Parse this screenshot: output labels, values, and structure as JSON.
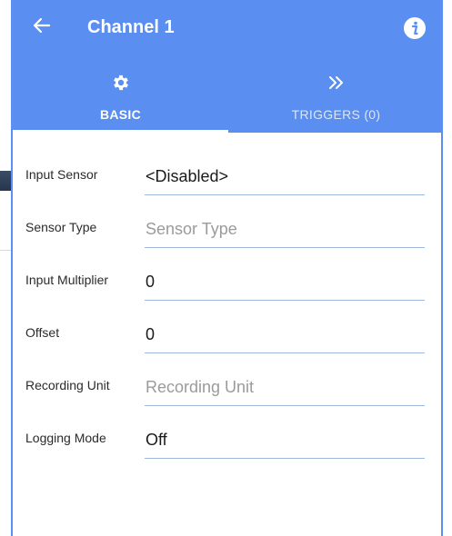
{
  "header": {
    "title": "Channel 1"
  },
  "tabs": [
    {
      "label": "BASIC",
      "icon": "gear-icon",
      "selected": true
    },
    {
      "label": "TRIGGERS (0)",
      "icon": "double-chevron-right-icon",
      "selected": false
    }
  ],
  "form": {
    "fields": [
      {
        "label": "Input Sensor",
        "value": "<Disabled>",
        "placeholder": ""
      },
      {
        "label": "Sensor Type",
        "value": "",
        "placeholder": "Sensor Type"
      },
      {
        "label": "Input Multiplier",
        "value": "0",
        "placeholder": ""
      },
      {
        "label": "Offset",
        "value": "0",
        "placeholder": ""
      },
      {
        "label": "Recording Unit",
        "value": "",
        "placeholder": "Recording Unit"
      },
      {
        "label": "Logging Mode",
        "value": "Off",
        "placeholder": ""
      }
    ]
  },
  "colors": {
    "accent": "#5a8ef0",
    "underline": "#9fb7dc",
    "placeholder": "#9b9b9b"
  }
}
